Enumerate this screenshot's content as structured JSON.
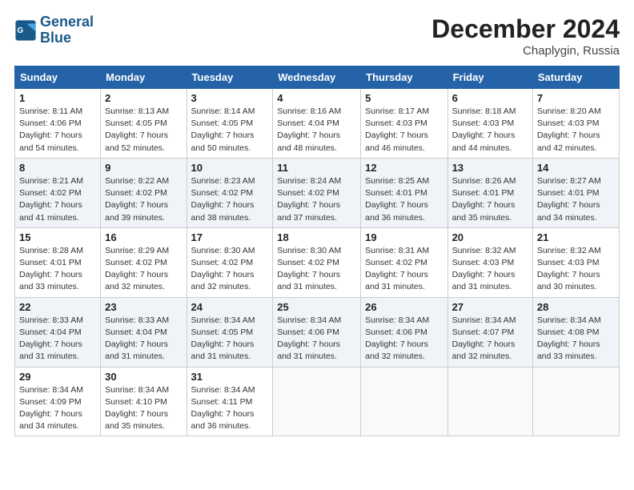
{
  "header": {
    "logo_line1": "General",
    "logo_line2": "Blue",
    "month": "December 2024",
    "location": "Chaplygin, Russia"
  },
  "weekdays": [
    "Sunday",
    "Monday",
    "Tuesday",
    "Wednesday",
    "Thursday",
    "Friday",
    "Saturday"
  ],
  "weeks": [
    [
      {
        "day": "1",
        "info": "Sunrise: 8:11 AM\nSunset: 4:06 PM\nDaylight: 7 hours\nand 54 minutes."
      },
      {
        "day": "2",
        "info": "Sunrise: 8:13 AM\nSunset: 4:05 PM\nDaylight: 7 hours\nand 52 minutes."
      },
      {
        "day": "3",
        "info": "Sunrise: 8:14 AM\nSunset: 4:05 PM\nDaylight: 7 hours\nand 50 minutes."
      },
      {
        "day": "4",
        "info": "Sunrise: 8:16 AM\nSunset: 4:04 PM\nDaylight: 7 hours\nand 48 minutes."
      },
      {
        "day": "5",
        "info": "Sunrise: 8:17 AM\nSunset: 4:03 PM\nDaylight: 7 hours\nand 46 minutes."
      },
      {
        "day": "6",
        "info": "Sunrise: 8:18 AM\nSunset: 4:03 PM\nDaylight: 7 hours\nand 44 minutes."
      },
      {
        "day": "7",
        "info": "Sunrise: 8:20 AM\nSunset: 4:03 PM\nDaylight: 7 hours\nand 42 minutes."
      }
    ],
    [
      {
        "day": "8",
        "info": "Sunrise: 8:21 AM\nSunset: 4:02 PM\nDaylight: 7 hours\nand 41 minutes."
      },
      {
        "day": "9",
        "info": "Sunrise: 8:22 AM\nSunset: 4:02 PM\nDaylight: 7 hours\nand 39 minutes."
      },
      {
        "day": "10",
        "info": "Sunrise: 8:23 AM\nSunset: 4:02 PM\nDaylight: 7 hours\nand 38 minutes."
      },
      {
        "day": "11",
        "info": "Sunrise: 8:24 AM\nSunset: 4:02 PM\nDaylight: 7 hours\nand 37 minutes."
      },
      {
        "day": "12",
        "info": "Sunrise: 8:25 AM\nSunset: 4:01 PM\nDaylight: 7 hours\nand 36 minutes."
      },
      {
        "day": "13",
        "info": "Sunrise: 8:26 AM\nSunset: 4:01 PM\nDaylight: 7 hours\nand 35 minutes."
      },
      {
        "day": "14",
        "info": "Sunrise: 8:27 AM\nSunset: 4:01 PM\nDaylight: 7 hours\nand 34 minutes."
      }
    ],
    [
      {
        "day": "15",
        "info": "Sunrise: 8:28 AM\nSunset: 4:01 PM\nDaylight: 7 hours\nand 33 minutes."
      },
      {
        "day": "16",
        "info": "Sunrise: 8:29 AM\nSunset: 4:02 PM\nDaylight: 7 hours\nand 32 minutes."
      },
      {
        "day": "17",
        "info": "Sunrise: 8:30 AM\nSunset: 4:02 PM\nDaylight: 7 hours\nand 32 minutes."
      },
      {
        "day": "18",
        "info": "Sunrise: 8:30 AM\nSunset: 4:02 PM\nDaylight: 7 hours\nand 31 minutes."
      },
      {
        "day": "19",
        "info": "Sunrise: 8:31 AM\nSunset: 4:02 PM\nDaylight: 7 hours\nand 31 minutes."
      },
      {
        "day": "20",
        "info": "Sunrise: 8:32 AM\nSunset: 4:03 PM\nDaylight: 7 hours\nand 31 minutes."
      },
      {
        "day": "21",
        "info": "Sunrise: 8:32 AM\nSunset: 4:03 PM\nDaylight: 7 hours\nand 30 minutes."
      }
    ],
    [
      {
        "day": "22",
        "info": "Sunrise: 8:33 AM\nSunset: 4:04 PM\nDaylight: 7 hours\nand 31 minutes."
      },
      {
        "day": "23",
        "info": "Sunrise: 8:33 AM\nSunset: 4:04 PM\nDaylight: 7 hours\nand 31 minutes."
      },
      {
        "day": "24",
        "info": "Sunrise: 8:34 AM\nSunset: 4:05 PM\nDaylight: 7 hours\nand 31 minutes."
      },
      {
        "day": "25",
        "info": "Sunrise: 8:34 AM\nSunset: 4:06 PM\nDaylight: 7 hours\nand 31 minutes."
      },
      {
        "day": "26",
        "info": "Sunrise: 8:34 AM\nSunset: 4:06 PM\nDaylight: 7 hours\nand 32 minutes."
      },
      {
        "day": "27",
        "info": "Sunrise: 8:34 AM\nSunset: 4:07 PM\nDaylight: 7 hours\nand 32 minutes."
      },
      {
        "day": "28",
        "info": "Sunrise: 8:34 AM\nSunset: 4:08 PM\nDaylight: 7 hours\nand 33 minutes."
      }
    ],
    [
      {
        "day": "29",
        "info": "Sunrise: 8:34 AM\nSunset: 4:09 PM\nDaylight: 7 hours\nand 34 minutes."
      },
      {
        "day": "30",
        "info": "Sunrise: 8:34 AM\nSunset: 4:10 PM\nDaylight: 7 hours\nand 35 minutes."
      },
      {
        "day": "31",
        "info": "Sunrise: 8:34 AM\nSunset: 4:11 PM\nDaylight: 7 hours\nand 36 minutes."
      },
      null,
      null,
      null,
      null
    ]
  ]
}
